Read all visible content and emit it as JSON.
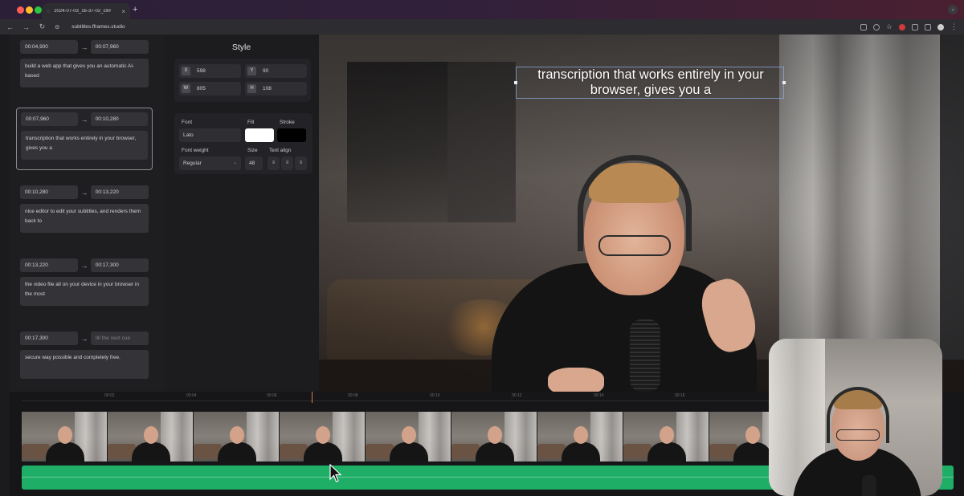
{
  "browser": {
    "tab_title": "2024-07-03_16-37-02_clnr",
    "url": "subtitles.fframes.studio",
    "colors": {
      "close": "#ff5f57",
      "minimize": "#febc2e",
      "maximize": "#28c840"
    }
  },
  "cues": [
    {
      "start": "00:04,900",
      "end": "00:07,960",
      "text": "build a web app that gives you an automatic AI-based"
    },
    {
      "start": "00:07,960",
      "end": "00:10,280",
      "text": "transcription that works entirely in your browser, gives you a"
    },
    {
      "start": "00:10,280",
      "end": "00:13,220",
      "text": "nice editor to edit your subtitles, and renders them back to"
    },
    {
      "start": "00:13,220",
      "end": "00:17,300",
      "text": "the video file all on your device in your browser in the most"
    },
    {
      "start": "00:17,300",
      "end": "till the next cue",
      "text": "secure way possible and completely free."
    }
  ],
  "style": {
    "title": "Style",
    "x": {
      "label": "X",
      "value": "598"
    },
    "y": {
      "label": "Y",
      "value": "90"
    },
    "w": {
      "label": "W",
      "value": "805"
    },
    "h": {
      "label": "H",
      "value": "108"
    },
    "font_label": "Font",
    "font_value": "Lato",
    "fill_label": "Fill",
    "fill_color": "#ffffff",
    "stroke_label": "Stroke",
    "stroke_color": "#000000",
    "weight_label": "Font weight",
    "weight_value": "Regular",
    "size_label": "Size",
    "size_value": "48",
    "align_label": "Text align"
  },
  "preview": {
    "caption": "transcription that works entirely in your browser, gives you a"
  },
  "timeline": {
    "ticks": [
      "00:02",
      "00:04",
      "00:06",
      "00:08",
      "00:10",
      "00:12",
      "00:14",
      "00:16"
    ],
    "accent": "#1fae66",
    "playhead_color": "#e07a3c"
  }
}
